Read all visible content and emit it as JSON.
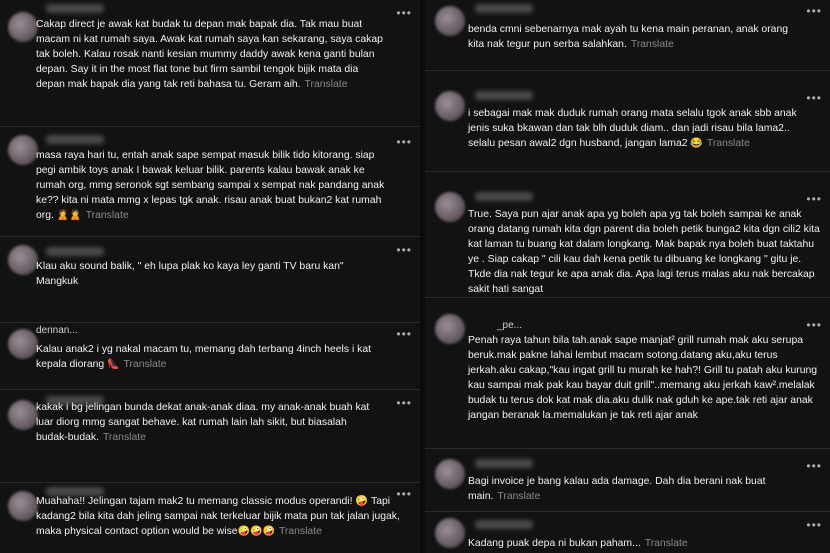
{
  "translate_label": "Translate",
  "left_posts": [
    {
      "text": "Cakap direct je awak kat budak tu depan mak bapak dia. Tak mau buat macam ni kat rumah saya. Awak kat rumah saya kan sekarang, saya cakap tak boleh. Kalau rosak nanti kesian mummy daddy awak kena ganti bulan depan. Say it in the most flat tone but firm sambil tengok bijik mata dia depan mak bapak dia yang tak reti bahasa tu. Geram aih.",
      "emoji": ""
    },
    {
      "text": "masa raya hari tu, entah anak sape sempat masuk bilik tido kitorang. siap pegi ambik toys anak I bawak keluar bilik. parents kalau bawak anak ke rumah org, mmg seronok sgt sembang sampai x sempat nak pandang anak ke?? kita ni mata mmg x lepas tgk anak. risau anak buat bukan2 kat rumah org.",
      "emoji": "🙎🙎"
    },
    {
      "text": "Klau aku sound balik, \" eh lupa plak ko kaya ley ganti TV baru kan\" Mangkuk",
      "emoji": ""
    },
    {
      "text": "Kalau anak2 i yg nakal macam tu, memang dah terbang 4inch heels i kat kepala diorang",
      "emoji": "👠",
      "peek": "dennan..."
    },
    {
      "text": "kakak i bg jelingan bunda dekat anak-anak diaa. my anak-anak buah kat luar diorg mmg sangat behave. kat rumah lain lah sikit, but biasalah budak-budak.",
      "emoji": ""
    },
    {
      "text": "Muahaha!! Jelingan tajam mak2 tu memang classic modus operandi! 🤪 Tapi kadang2 bila kita dah jeling sampai nak terkeluar bijik mata pun tak jalan jugak, maka physical contact option would be wise",
      "emoji": "🤪🤪🤪"
    }
  ],
  "right_posts": [
    {
      "text": "benda cmni sebenarnya mak ayah tu kena main peranan, anak orang kita nak tegur pun serba salahkan.",
      "emoji": ""
    },
    {
      "text": "i sebagai mak mak duduk rumah orang mata selalu tgok anak sbb anak jenis suka bkawan dan tak blh duduk diam.. dan jadi risau bila lama2.. selalu pesan awal2 dgn husband, jangan lama2",
      "emoji": "😂"
    },
    {
      "text": "True. Saya pun ajar anak apa yg boleh apa yg tak boleh sampai ke anak orang datang rumah kita dgn parent dia boleh petik bunga2 kita dgn cili2 kita kat laman tu buang kat dalam longkang. Mak bapak nya boleh buat taktahu ye . Siap cakap \" cili kau dah kena petik tu dibuang ke longkang \" gitu je. Tkde dia nak tegur ke apa anak dia. Apa lagi terus malas aku nak bercakap sakit hati sangat",
      "emoji": ""
    },
    {
      "text": "Penah raya tahun bila tah.anak sape manjat² grill rumah mak aku serupa beruk.mak pakne lahai lembut macam sotong.datang aku,aku terus jerkah.aku cakap,\"kau ingat grill tu murah ke hah?! Grill tu patah aku kurung kau sampai mak pak kau bayar duit grill\"..memang aku jerkah kaw².melalak budak tu terus dok kat mak dia.aku dulik nak gduh ke ape.tak reti ajar anak jangan beranak la.memalukan je tak reti ajar anak",
      "emoji": "",
      "peek": "_pe..."
    },
    {
      "text": "Bagi invoice je bang kalau ada damage. Dah dia berani nak buat main.",
      "emoji": ""
    },
    {
      "text": "Kadang puak depa ni bukan paham...",
      "emoji": ""
    }
  ],
  "more_icon": "•••"
}
